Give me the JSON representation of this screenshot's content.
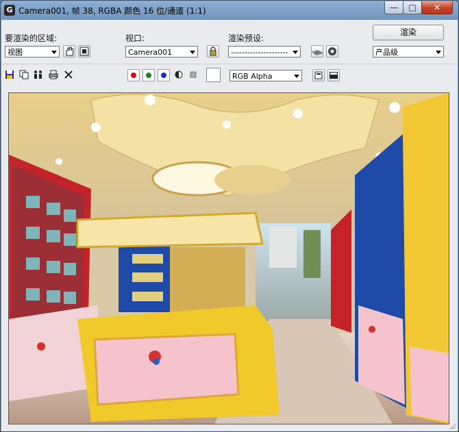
{
  "window": {
    "title": "Camera001, 帧 38, RGBA 颜色 16 位/通道 (1:1)",
    "app_icon": "3ds-max-icon",
    "minimize_symbol": "—",
    "maximize_symbol": "□",
    "close_symbol": "✕"
  },
  "controls": {
    "area_label": "要渲染的区域:",
    "area_value": "视图",
    "viewport_label": "视口:",
    "viewport_value": "Camera001",
    "preset_label": "渲染预设:",
    "preset_value": "---------------------",
    "render_button": "渲染",
    "quality_value": "产品级"
  },
  "toolbar": {
    "channel_value": "RGB Alpha",
    "colors": {
      "red": "#d01010",
      "green": "#108a20",
      "blue": "#1530c8"
    }
  }
}
